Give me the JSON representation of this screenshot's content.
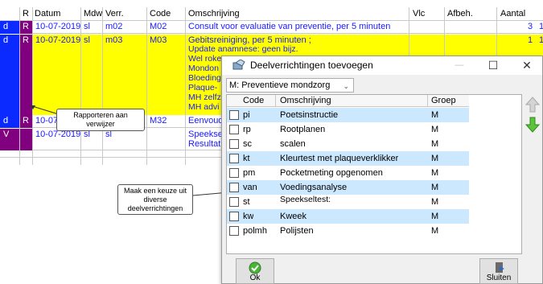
{
  "grid": {
    "columns": [
      "R",
      "Datum",
      "Mdw",
      "Verr.",
      "Code",
      "Omschrijving",
      "Vlc",
      "Afbeh.",
      "Aantal"
    ],
    "rows": [
      {
        "prefix": "d",
        "r": "R",
        "date": "10-07-2019",
        "mdw": "sl",
        "verr": "m02",
        "code": "M02",
        "desc": "Consult voor evaluatie van preventie, per 5 minuten",
        "aantal": "3",
        "extra": "1"
      },
      {
        "prefix": "d",
        "r": "R",
        "date": "10-07-2019",
        "mdw": "sl",
        "verr": "m03",
        "code": "M03",
        "desc": "Gebitsreiniging, per 5 minuten ;",
        "desc_lines": [
          "Update anamnese: geen bijz.",
          "Wel roke",
          "Mondon",
          "Bloeding",
          "Plaque-",
          "MH zelfz",
          "MH advi"
        ],
        "aantal": "1",
        "extra": "1"
      },
      {
        "prefix": "d",
        "r": "R",
        "date": "10-07",
        "code": "M32",
        "desc": "Eenvoud"
      },
      {
        "prefix": "V",
        "date": "10-07-2019",
        "mdw": "sl",
        "verr": "sl",
        "desc": "Speekse",
        "desc2": "Resultat"
      }
    ]
  },
  "dialog": {
    "title": "Deelverrichtingen toevoegen",
    "controls": {
      "minimize": "—",
      "maximize": "☐",
      "close": "✕"
    },
    "category_select": "M: Preventieve mondzorg",
    "list_headers": [
      "Code",
      "Omschrijving",
      "Groep"
    ],
    "items": [
      {
        "code": "pi",
        "desc": "Poetsinstructie",
        "group": "M"
      },
      {
        "code": "rp",
        "desc": "Rootplanen",
        "group": "M"
      },
      {
        "code": "sc",
        "desc": "scalen",
        "group": "M"
      },
      {
        "code": "kt",
        "desc": "Kleurtest met plaqueverklikker",
        "group": "M"
      },
      {
        "code": "pm",
        "desc": "Pocketmeting opgenomen",
        "group": "M"
      },
      {
        "code": "van",
        "desc": "Voedingsanalyse",
        "group": "M"
      },
      {
        "code": "st",
        "desc": "Speekseltest:",
        "group": "M"
      },
      {
        "code": "kw",
        "desc": "Kweek",
        "group": "M"
      },
      {
        "code": "polmh",
        "desc": "Polijsten",
        "group": "M"
      }
    ],
    "ok_label": "Ok",
    "close_label": "Sluiten"
  },
  "callouts": {
    "rapporteren": [
      "Rapporteren aan",
      "verwijzer"
    ],
    "keuze": [
      "Maak een keuze uit",
      "diverse",
      "deelverrichtingen"
    ]
  },
  "colors": {
    "highlight_yellow": "#ffff00",
    "r_purple": "#800080",
    "selection_blue": "#0a2aff",
    "link_blue": "#1a1aff",
    "row_alt": "#cce8ff"
  }
}
